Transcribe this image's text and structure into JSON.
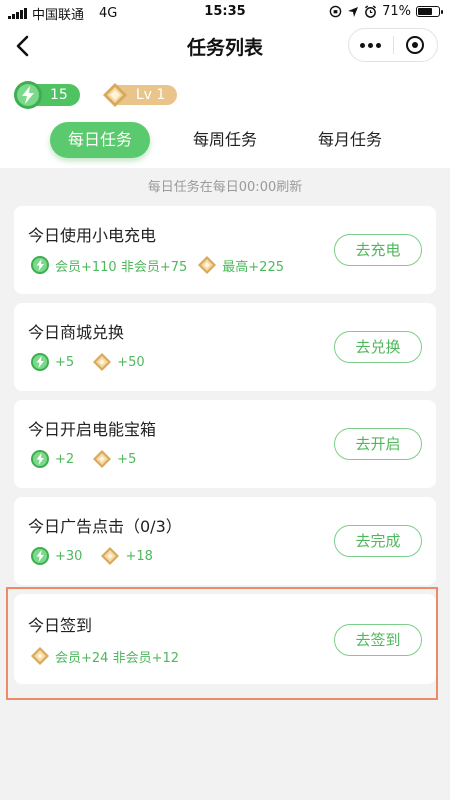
{
  "status_bar": {
    "carrier": "中国联通",
    "network": "4G",
    "time": "15:35",
    "battery": "71%",
    "battery_level": 0.71
  },
  "nav": {
    "title": "任务列表"
  },
  "currency": {
    "energy": "15",
    "level": "Lv 1"
  },
  "tabs": [
    {
      "label": "每日任务",
      "active": true
    },
    {
      "label": "每周任务",
      "active": false
    },
    {
      "label": "每月任务",
      "active": false
    }
  ],
  "refresh_note": "每日任务在每日00:00刷新",
  "tasks": [
    {
      "title": "今日使用小电充电",
      "rewards": [
        {
          "icon": "green-energy-icon",
          "text": "会员+110 非会员+75"
        },
        {
          "icon": "gold-diamond-icon",
          "text": "最高+225"
        }
      ],
      "button": "去充电"
    },
    {
      "title": "今日商城兑换",
      "rewards": [
        {
          "icon": "green-energy-icon",
          "text": "+5"
        },
        {
          "icon": "gold-diamond-icon",
          "text": "+50"
        }
      ],
      "button": "去兑换"
    },
    {
      "title": "今日开启电能宝箱",
      "rewards": [
        {
          "icon": "green-energy-icon",
          "text": "+2"
        },
        {
          "icon": "gold-diamond-icon",
          "text": "+5"
        }
      ],
      "button": "去开启"
    },
    {
      "title": "今日广告点击（0/3）",
      "rewards": [
        {
          "icon": "green-energy-icon",
          "text": "+30"
        },
        {
          "icon": "gold-diamond-icon",
          "text": "+18"
        }
      ],
      "button": "去完成"
    },
    {
      "title": "今日签到",
      "rewards": [
        {
          "icon": "gold-diamond-icon",
          "text": "会员+24 非会员+12"
        }
      ],
      "button": "去签到"
    }
  ],
  "colors": {
    "accent_green": "#5bc96d",
    "reward_text": "#4fb85d",
    "gold": "#e9c58b",
    "highlight_border": "#ec8a6a"
  }
}
